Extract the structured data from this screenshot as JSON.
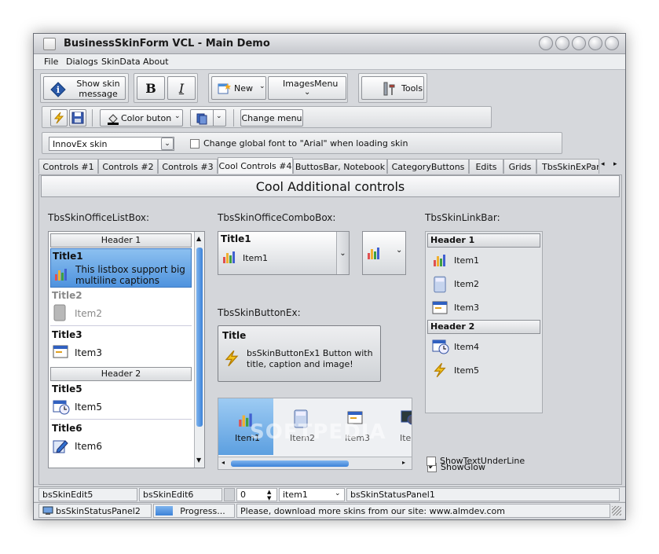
{
  "window": {
    "title": "BusinessSkinForm VCL - Main Demo"
  },
  "menu": [
    "File",
    "Dialogs",
    "SkinData",
    "About"
  ],
  "toolbar1": {
    "show_skin_message": "Show skin message",
    "bold": "B",
    "italic": "I",
    "new": "New",
    "images_menu": "ImagesMenu",
    "tools": "Tools"
  },
  "toolbar2": {
    "color_button": "Color buton",
    "change_menu": "Change menu"
  },
  "toolbar3": {
    "skin_select": "InnovEx skin",
    "change_font": "Change global font to \"Arial\" when loading skin"
  },
  "tabs": [
    "Controls #1",
    "Controls #2",
    "Controls #3",
    "Cool Controls #4",
    "ButtosBar, Notebook",
    "CategoryButtons",
    "Edits",
    "Grids",
    "TbsSkinExPan"
  ],
  "content": {
    "heading": "Cool Additional controls",
    "office_listbox_label": "TbsSkinOfficeListBox:",
    "office_combobox_label": "TbsSkinOfficeComboBox:",
    "linkbar_label": "TbsSkinLinkBar:",
    "buttonex_label": "TbsSkinButtonEx:"
  },
  "listbox": {
    "header1": "Header 1",
    "header2": "Header 2",
    "items": [
      {
        "title": "Title1",
        "text": "This listbox support big multiline captions"
      },
      {
        "title": "Title2",
        "text": "Item2"
      },
      {
        "title": "Title3",
        "text": "Item3"
      },
      {
        "title": "Title5",
        "text": "Item5"
      },
      {
        "title": "Title6",
        "text": "Item6"
      }
    ]
  },
  "combobox": {
    "title": "Title1",
    "item": "Item1"
  },
  "buttonex": {
    "title": "Title",
    "text": "bsSkinButtonEx1 Button with title, caption and image!"
  },
  "imagebar": [
    "Item1",
    "Item2",
    "Item3",
    "Ite"
  ],
  "linkbar": {
    "header1": "Header 1",
    "header2": "Header 2",
    "group1": [
      "Item1",
      "Item2",
      "Item3"
    ],
    "group2": [
      "Item4",
      "Item5"
    ]
  },
  "checks": {
    "show_glow": "ShowGlow",
    "show_text_underline": "ShowTextUnderLine"
  },
  "status1": {
    "edit5": "bsSkinEdit5",
    "edit6": "bsSkinEdit6",
    "spin_value": "0",
    "combo_value": "item1",
    "panel1": "bsSkinStatusPanel1"
  },
  "status2": {
    "panel2": "bsSkinStatusPanel2",
    "progress": "Progress...",
    "message": "Please, download more skins from our site: www.almdev.com"
  },
  "watermark": "SOFTPEDIA"
}
